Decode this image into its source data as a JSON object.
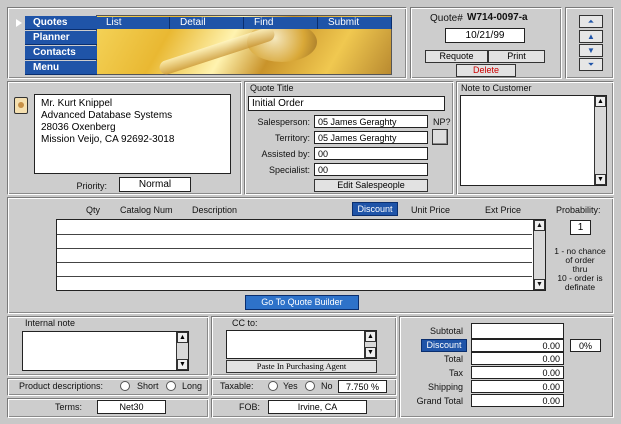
{
  "nav": {
    "items": [
      {
        "label": "Quotes",
        "active": true
      },
      {
        "label": "Planner"
      },
      {
        "label": "Contacts"
      },
      {
        "label": "Menu"
      }
    ]
  },
  "tabs": [
    "List",
    "Detail",
    "Find",
    "Submit"
  ],
  "quote": {
    "number_label": "Quote#",
    "number": "W714-0097-a",
    "date": "10/21/99",
    "requote_label": "Requote",
    "print_label": "Print",
    "delete_label": "Delete"
  },
  "customer": {
    "lines": [
      "Mr. Kurt Knippel",
      "Advanced Database Systems",
      "28036 Oxenberg",
      "Mission Veijo, CA  92692-3018"
    ],
    "priority_label": "Priority:",
    "priority": "Normal"
  },
  "quote_info": {
    "title_label": "Quote Title",
    "title": "Initial Order",
    "salesperson_label": "Salesperson:",
    "salesperson": "05  James Geraghty",
    "territory_label": "Territory:",
    "territory": "05  James Geraghty",
    "assisted_label": "Assisted by:",
    "assisted": "00",
    "specialist_label": "Specialist:",
    "specialist": "00",
    "np_label": "NP?",
    "edit_label": "Edit Salespeople"
  },
  "note_customer_label": "Note to Customer",
  "items": {
    "headers": {
      "qty": "Qty",
      "catalog": "Catalog Num",
      "description": "Description",
      "discount": "Discount",
      "unit_price": "Unit Price",
      "ext_price": "Ext Price"
    },
    "probability_label": "Probability:",
    "probability": "1",
    "probability_legend": [
      "1 - no chance",
      "of order",
      "thru",
      "10 - order is",
      "definate"
    ],
    "builder_label": "Go To Quote Builder"
  },
  "internal_note_label": "Internal note",
  "cc": {
    "label": "CC to:",
    "paste_label": "Paste In Purchasing Agent"
  },
  "options": {
    "product_desc_label": "Product descriptions:",
    "short_label": "Short",
    "long_label": "Long",
    "taxable_label": "Taxable:",
    "yes_label": "Yes",
    "no_label": "No",
    "tax_rate": "7.750 %",
    "terms_label": "Terms:",
    "terms": "Net30",
    "fob_label": "FOB:",
    "fob": "Irvine, CA"
  },
  "totals": {
    "subtotal_label": "Subtotal",
    "discount_label": "Discount",
    "discount": "0.00",
    "discount_pct": "0%",
    "total_label": "Total",
    "total": "0.00",
    "tax_label": "Tax",
    "tax": "0.00",
    "shipping_label": "Shipping",
    "shipping": "0.00",
    "grand_total_label": "Grand Total",
    "grand_total": "0.00"
  },
  "colors": {
    "accent": "#1f54a8",
    "panel": "#cdcdcd",
    "delete": "#cc0000"
  }
}
